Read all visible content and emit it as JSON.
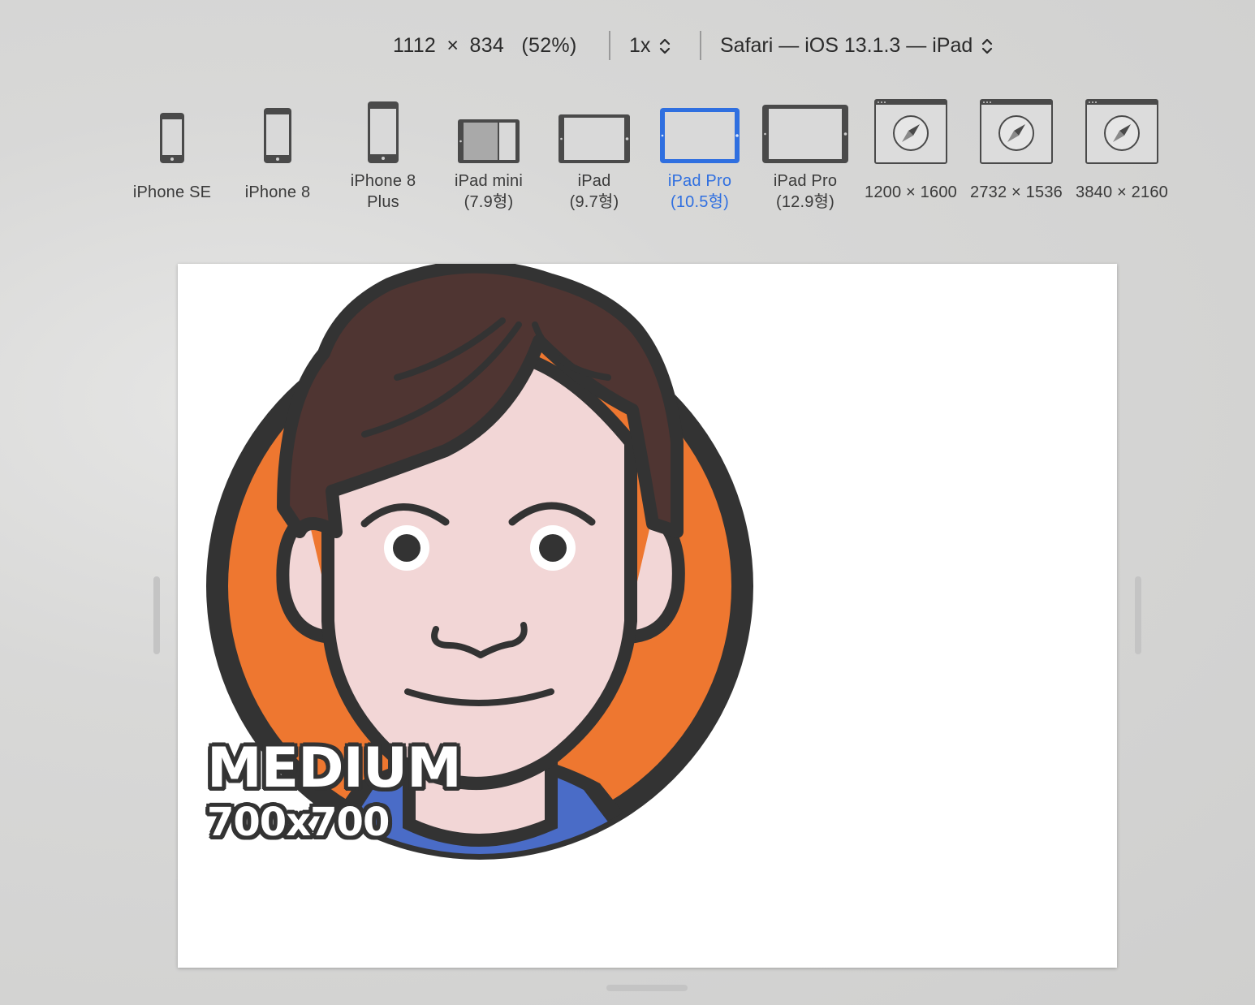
{
  "toolbar": {
    "width": "1112",
    "times": "×",
    "height": "834",
    "percent": "(52%)",
    "scale": "1x",
    "user_agent": "Safari — iOS 13.1.3 — iPad"
  },
  "devices": [
    {
      "line1": "iPhone SE",
      "line2": ""
    },
    {
      "line1": "iPhone 8",
      "line2": ""
    },
    {
      "line1": "iPhone 8",
      "line2": "Plus"
    },
    {
      "line1": "iPad mini",
      "line2": "(7.9형)"
    },
    {
      "line1": "iPad",
      "line2": "(9.7형)"
    },
    {
      "line1": "iPad Pro",
      "line2": "(10.5형)",
      "selected": true
    },
    {
      "line1": "iPad Pro",
      "line2": "(12.9형)"
    },
    {
      "line1": "1200 × 1600",
      "line2": ""
    },
    {
      "line1": "2732 × 1536",
      "line2": ""
    },
    {
      "line1": "3840 × 2160",
      "line2": ""
    }
  ],
  "page": {
    "badge_title": "MEDIUM",
    "badge_subtitle": "700x700"
  },
  "colors": {
    "accent": "#2f6fe0",
    "avatar_bg": "#ee7730",
    "hair": "#4f3532",
    "skin": "#f2d6d6",
    "shirt": "#4a6cc7",
    "outline": "#333333"
  }
}
